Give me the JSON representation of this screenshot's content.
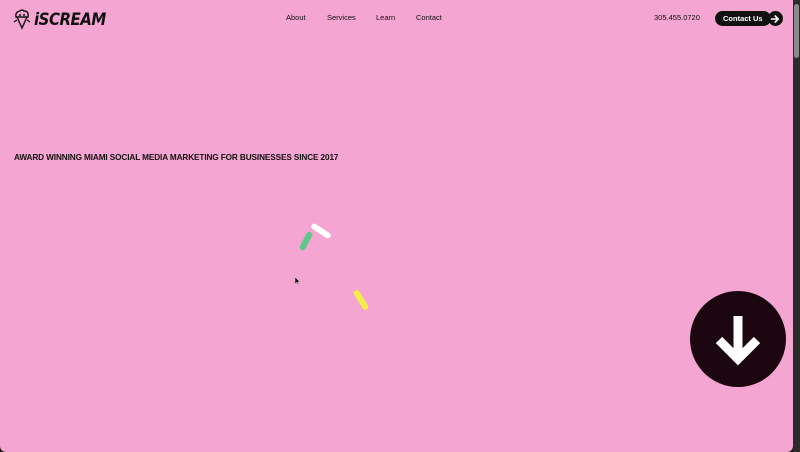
{
  "brand": {
    "name": "iSCREAM",
    "icon": "ice-cream-mascot-icon"
  },
  "nav": {
    "items": [
      {
        "label": "About"
      },
      {
        "label": "Services"
      },
      {
        "label": "Learn"
      },
      {
        "label": "Contact"
      }
    ]
  },
  "header": {
    "phone": "305.455.0720",
    "cta_label": "Contact Us",
    "cta_icon": "arrow-right-icon"
  },
  "hero": {
    "tagline": "AWARD WINNING MIAMI SOCIAL MEDIA MARKETING FOR BUSINESSES SINCE 2017",
    "scroll_icon": "arrow-down-icon"
  },
  "colors": {
    "background": "#f4a5d1",
    "text": "#111111",
    "button": "#111111",
    "scroll_button": "#1c0610",
    "sprinkle_white": "#ffffff",
    "sprinkle_green": "#5cc98a",
    "sprinkle_yellow": "#f5ee48"
  }
}
